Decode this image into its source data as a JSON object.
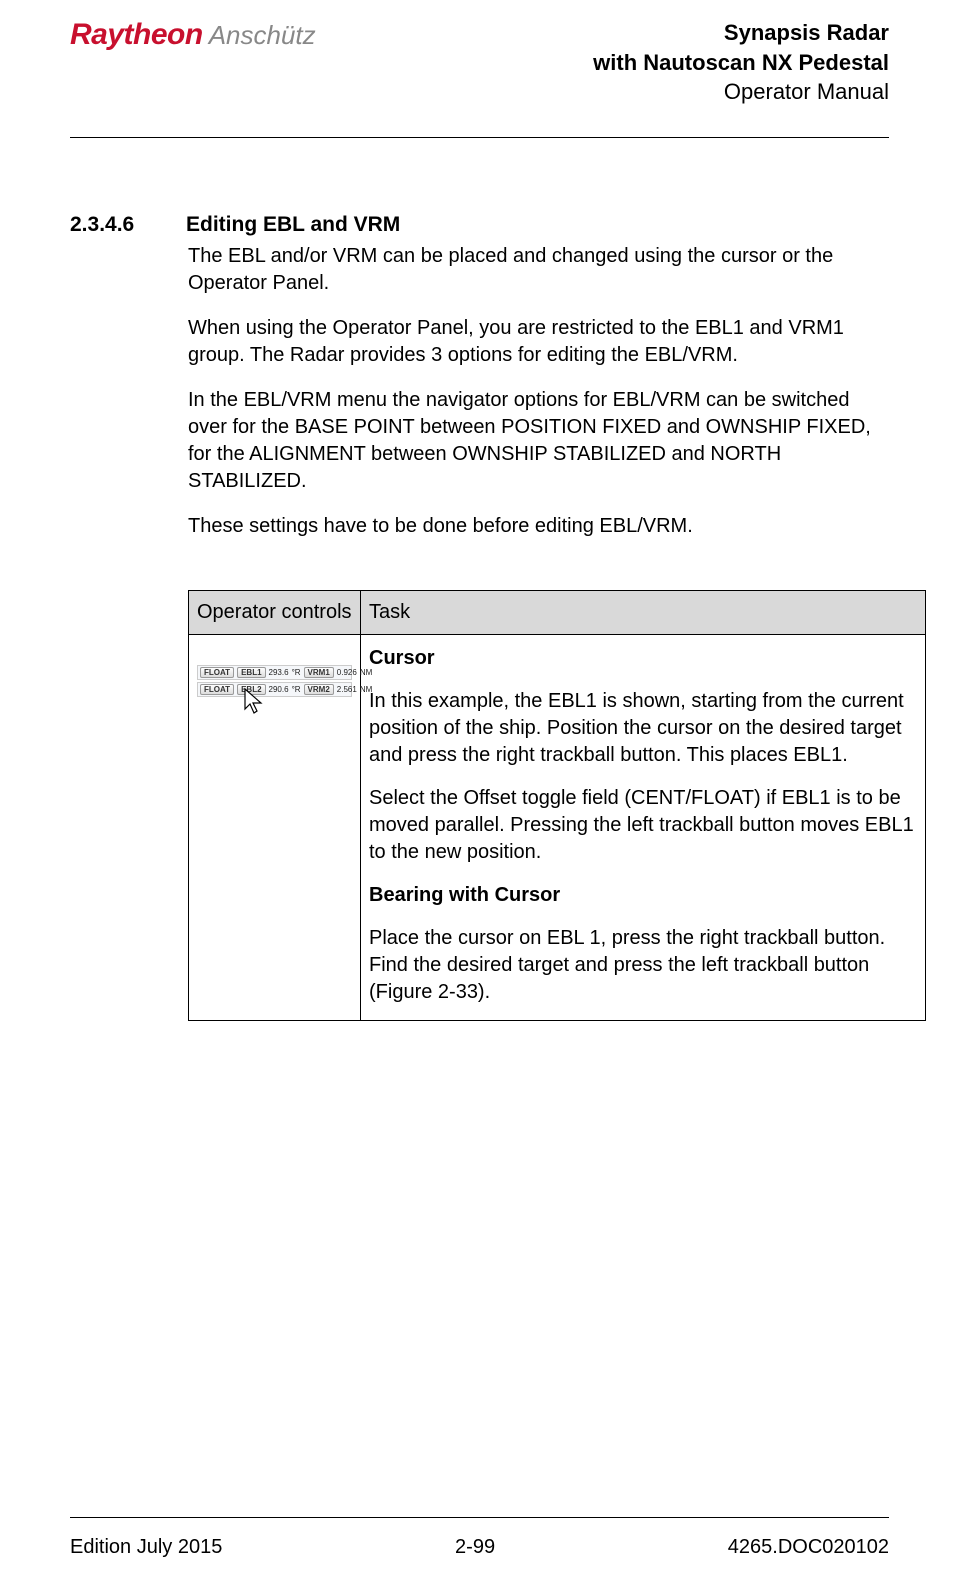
{
  "header": {
    "logo_red": "Raytheon",
    "logo_gray": "Anschütz",
    "title_line1": "Synapsis Radar",
    "title_line2": "with Nautoscan NX Pedestal",
    "title_line3": "Operator Manual"
  },
  "section": {
    "number": "2.3.4.6",
    "title": "Editing EBL and VRM",
    "para1": "The EBL and/or VRM can be placed and changed using the cursor or the Operator Panel.",
    "para2": "When using the Operator Panel, you are restricted to the EBL1 and VRM1 group. The Radar provides 3 options for editing the EBL/VRM.",
    "para3": "In the EBL/VRM menu the navigator options for EBL/VRM can be switched over for the BASE POINT between POSITION FIXED and OWNSHIP FIXED, for the ALIGNMENT between OWNSHIP STABILIZED and NORTH STABILIZED.",
    "para4": "These settings have to be done before editing EBL/VRM."
  },
  "table": {
    "header_col1": "Operator controls",
    "header_col2": "Task",
    "operator_image": {
      "row1": {
        "float": "FLOAT",
        "ebl": "EBL1",
        "bearing": "293.6",
        "r": "°R",
        "vrm": "VRM1",
        "range": "0.926",
        "unit": "NM"
      },
      "row2": {
        "float": "FLOAT",
        "ebl": "EBL2",
        "bearing": "290.6",
        "r": "°R",
        "vrm": "VRM2",
        "range": "2.561",
        "unit": "NM"
      }
    },
    "task": {
      "h1": "Cursor",
      "p1": "In this example, the EBL1 is shown, starting from the current position of the ship. Position the cursor on the desired target and press the right trackball button. This places EBL1.",
      "p2": "Select the Offset toggle field (CENT/FLOAT) if EBL1 is to be moved parallel. Pressing the left trackball button moves EBL1 to the new position.",
      "h2": "Bearing with Cursor",
      "p3": "Place the cursor on EBL 1, press the right trackball button. Find the desired target and press the left trackball button (Figure 2-33)."
    }
  },
  "footer": {
    "left": "Edition July 2015",
    "center": "2-99",
    "right": "4265.DOC020102"
  }
}
